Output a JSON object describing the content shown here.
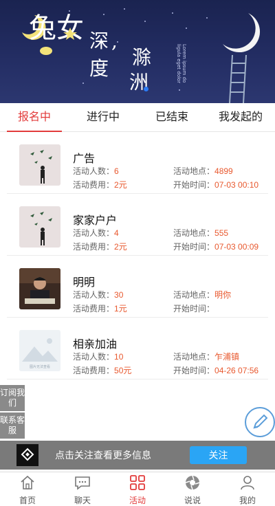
{
  "banner": {
    "logo_text": "兔女",
    "title_parts": [
      "深,",
      "度",
      "滁",
      "洲"
    ],
    "english": "Lorem ipsum do ligula eget dolor"
  },
  "tabs": [
    {
      "label": "报名中",
      "active": true
    },
    {
      "label": "进行中",
      "active": false
    },
    {
      "label": "已结束",
      "active": false
    },
    {
      "label": "我发起的",
      "active": false
    }
  ],
  "activities": [
    {
      "title": "广告",
      "people_label": "活动人数：",
      "people": "6",
      "place_label": "活动地点：",
      "place": "4899",
      "fee_label": "活动费用：",
      "fee": "2元",
      "time_label": "开始时间：",
      "time": "07-03 00:10",
      "thumb": "birds-and-man"
    },
    {
      "title": "家家户户",
      "people_label": "活动人数：",
      "people": "4",
      "place_label": "活动地点：",
      "place": "555",
      "fee_label": "活动费用：",
      "fee": "2元",
      "time_label": "开始时间：",
      "time": "07-03 00:09",
      "thumb": "birds-and-man"
    },
    {
      "title": "明明",
      "people_label": "活动人数：",
      "people": "30",
      "place_label": "活动地点：",
      "place": "明你",
      "fee_label": "活动费用：",
      "fee": "1元",
      "time_label": "开始时间：",
      "time": "",
      "thumb": "man-reading"
    },
    {
      "title": "相亲加油",
      "people_label": "活动人数：",
      "people": "10",
      "place_label": "活动地点：",
      "place": "乍浦镇",
      "fee_label": "活动费用：",
      "fee": "50元",
      "time_label": "开始时间：",
      "time": "04-26 07:56",
      "thumb": "placeholder",
      "thumb_text": "图片无法查看"
    }
  ],
  "side": {
    "subscribe": "订阅我们",
    "service": "联系客服"
  },
  "follow_bar": {
    "text": "点击关注查看更多信息",
    "button": "关注"
  },
  "nav": [
    {
      "label": "首页",
      "icon": "home-icon",
      "active": false
    },
    {
      "label": "聊天",
      "icon": "chat-icon",
      "active": false
    },
    {
      "label": "活动",
      "icon": "grid-icon",
      "active": true
    },
    {
      "label": "说说",
      "icon": "camera-shutter-icon",
      "active": false
    },
    {
      "label": "我的",
      "icon": "person-icon",
      "active": false
    }
  ],
  "colors": {
    "accent": "#e23b3b",
    "value": "#e8582e",
    "follow_button": "#2aa5f5",
    "banner": "#232d63"
  }
}
